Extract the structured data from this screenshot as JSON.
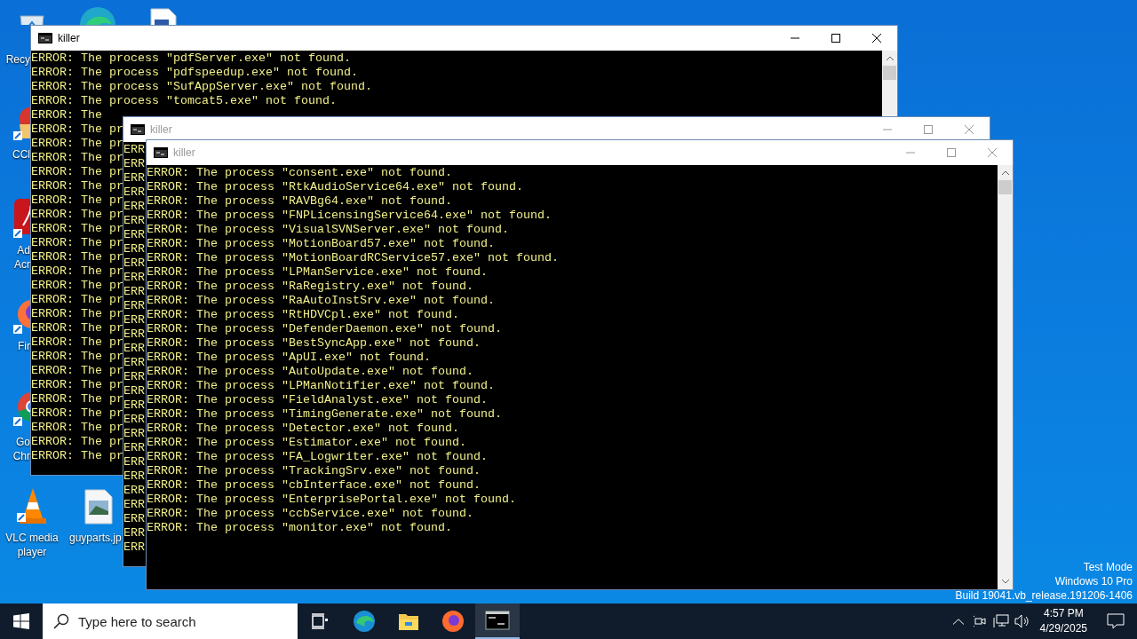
{
  "desktop_icons": [
    {
      "kind": "recycle",
      "label_lines": [
        "Recy"
      ]
    },
    {
      "kind": "edge"
    },
    {
      "kind": "document"
    },
    {
      "kind": "ccleaner",
      "label_lines": [
        "CCl"
      ]
    },
    {
      "kind": "acrobat",
      "label_lines": [
        "Ad",
        "Acr"
      ]
    },
    {
      "kind": "firefox",
      "label_lines": [
        "Fir"
      ]
    },
    {
      "kind": "chrome",
      "label_lines": [
        "Go",
        "Chr"
      ]
    },
    {
      "kind": "vlc",
      "label_lines": [
        "VLC media",
        "player"
      ]
    },
    {
      "kind": "image",
      "label_lines": [
        "guyparts.jp"
      ]
    }
  ],
  "windows": [
    {
      "title": "killer",
      "active": true,
      "lines": [
        "ERROR: The process \"pdfServer.exe\" not found.",
        "ERROR: The process \"pdfspeedup.exe\" not found.",
        "ERROR: The process \"SufAppServer.exe\" not found.",
        "ERROR: The process \"tomcat5.exe\" not found.",
        "ERROR: The",
        "ERROR: The pr",
        "ERROR: The pr",
        "ERROR: The pr",
        "ERROR: The pr",
        "ERROR: The pr",
        "ERROR: The pr",
        "ERROR: The pr",
        "ERROR: The pr",
        "ERROR: The pr",
        "ERROR: The pr",
        "ERROR: The pr",
        "ERROR: The pr",
        "ERROR: The pr",
        "ERROR: The pr",
        "ERROR: The pr",
        "ERROR: The pr",
        "ERROR: The pr",
        "ERROR: The pr",
        "ERROR: The pr",
        "ERROR: The pr",
        "ERROR: The pr",
        "ERROR: The pr",
        "ERROR: The pr",
        "ERROR: The pr"
      ]
    },
    {
      "title": "killer",
      "active": false,
      "lines": [
        "ERR",
        "ERR",
        "ERR",
        "ERR",
        "ERR",
        "ERR",
        "ERR",
        "ERR",
        "ERR",
        "ERR",
        "ERR",
        "ERR",
        "ERR",
        "ERR",
        "ERR",
        "ERR",
        "ERR",
        "ERR",
        "ERR",
        "ERR",
        "ERR",
        "ERR",
        "ERR",
        "ERR",
        "ERR",
        "ERR",
        "ERR",
        "ERR",
        "ERR"
      ]
    },
    {
      "title": "killer",
      "active": false,
      "lines": [
        "ERROR: The process \"consent.exe\" not found.",
        "ERROR: The process \"RtkAudioService64.exe\" not found.",
        "ERROR: The process \"RAVBg64.exe\" not found.",
        "ERROR: The process \"FNPLicensingService64.exe\" not found.",
        "ERROR: The process \"VisualSVNServer.exe\" not found.",
        "ERROR: The process \"MotionBoard57.exe\" not found.",
        "ERROR: The process \"MotionBoardRCService57.exe\" not found.",
        "ERROR: The process \"LPManService.exe\" not found.",
        "ERROR: The process \"RaRegistry.exe\" not found.",
        "ERROR: The process \"RaAutoInstSrv.exe\" not found.",
        "ERROR: The process \"RtHDVCpl.exe\" not found.",
        "ERROR: The process \"DefenderDaemon.exe\" not found.",
        "ERROR: The process \"BestSyncApp.exe\" not found.",
        "ERROR: The process \"ApUI.exe\" not found.",
        "ERROR: The process \"AutoUpdate.exe\" not found.",
        "ERROR: The process \"LPManNotifier.exe\" not found.",
        "ERROR: The process \"FieldAnalyst.exe\" not found.",
        "ERROR: The process \"TimingGenerate.exe\" not found.",
        "ERROR: The process \"Detector.exe\" not found.",
        "ERROR: The process \"Estimator.exe\" not found.",
        "ERROR: The process \"FA_Logwriter.exe\" not found.",
        "ERROR: The process \"TrackingSrv.exe\" not found.",
        "ERROR: The process \"cbInterface.exe\" not found.",
        "ERROR: The process \"EnterprisePortal.exe\" not found.",
        "ERROR: The process \"ccbService.exe\" not found.",
        "ERROR: The process \"monitor.exe\" not found."
      ]
    }
  ],
  "desktop_text": [
    "Test Mode",
    "Windows 10 Pro",
    "Build 19041.vb_release.191206-1406"
  ],
  "taskbar": {
    "search": {
      "placeholder": "Type here to search"
    },
    "apps": [
      {
        "kind": "taskview",
        "selected": false
      },
      {
        "kind": "edge",
        "selected": false
      },
      {
        "kind": "explorer",
        "selected": false
      },
      {
        "kind": "firefox",
        "selected": false
      },
      {
        "kind": "console",
        "selected": true
      }
    ],
    "clock": {
      "time": "4:57 PM",
      "date": "4/29/2025"
    }
  }
}
